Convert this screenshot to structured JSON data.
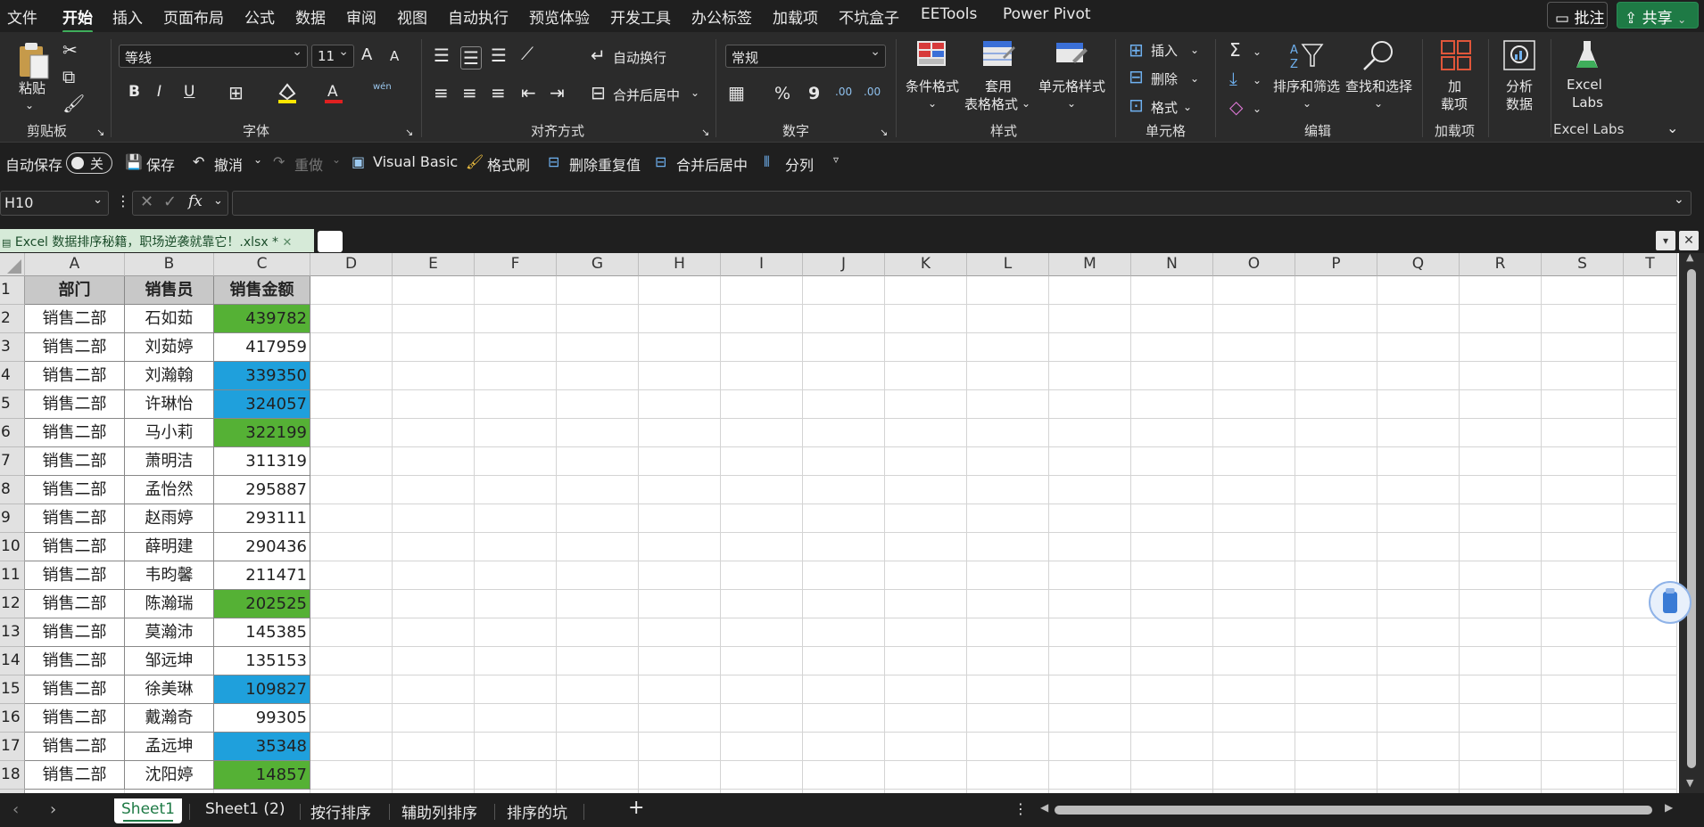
{
  "menubar": {
    "items": [
      "文件",
      "开始",
      "插入",
      "页面布局",
      "公式",
      "数据",
      "审阅",
      "视图",
      "自动执行",
      "预览体验",
      "开发工具",
      "办公标签",
      "加载项",
      "不坑盒子",
      "EETools",
      "Power Pivot"
    ],
    "active": "开始",
    "comments_label": "批注",
    "share_label": "共享"
  },
  "ribbon": {
    "clipboard": {
      "paste": "粘贴",
      "label": "剪贴板"
    },
    "font": {
      "name": "等线",
      "size": "11",
      "bold": "B",
      "italic": "I",
      "underline": "U",
      "label": "字体",
      "grow": "A",
      "shrink": "A",
      "pinyin": "wén"
    },
    "alignment": {
      "wrap": "自动换行",
      "merge": "合并后居中",
      "label": "对齐方式"
    },
    "number": {
      "format": "常规",
      "percent": "%",
      "comma": "9",
      "inc": ".00",
      "dec": ".00",
      "label": "数字"
    },
    "styles": {
      "conditional": "条件格式",
      "table_line1": "套用",
      "table_line2": "表格格式",
      "cell_styles": "单元格样式",
      "label": "样式"
    },
    "cells": {
      "insert": "插入",
      "delete": "删除",
      "format": "格式",
      "label": "单元格"
    },
    "editing": {
      "sort": "排序和筛选",
      "find": "查找和选择",
      "label": "编辑"
    },
    "addins": {
      "line1": "加",
      "line2": "载项",
      "label": "加载项"
    },
    "analyze": {
      "line1": "分析",
      "line2": "数据"
    },
    "labs": {
      "line1": "Excel",
      "line2": "Labs",
      "label": "Excel Labs"
    }
  },
  "qat": {
    "autosave": "自动保存",
    "toggle": "关",
    "save": "保存",
    "undo": "撤消",
    "redo": "重做",
    "vba": "Visual Basic",
    "painter": "格式刷",
    "dedupe": "删除重复值",
    "merge": "合并后居中",
    "split": "分列"
  },
  "formula_bar": {
    "cell_ref": "H10",
    "fx": "fx",
    "value": ""
  },
  "file_tab": {
    "name": "Excel 数据排序秘籍，职场逆袭就靠它！.xlsx *"
  },
  "grid": {
    "columns": [
      "A",
      "B",
      "C",
      "D",
      "E",
      "F",
      "G",
      "H",
      "I",
      "J",
      "K",
      "L",
      "M",
      "N",
      "O",
      "P",
      "Q",
      "R",
      "S",
      "T"
    ],
    "headers": [
      "部门",
      "销售员",
      "销售金额"
    ],
    "rows": [
      {
        "n": "2",
        "dept": "销售二部",
        "name": "石如茹",
        "amount": "439782",
        "fill": "#55b135"
      },
      {
        "n": "3",
        "dept": "销售二部",
        "name": "刘茹婷",
        "amount": "417959",
        "fill": ""
      },
      {
        "n": "4",
        "dept": "销售二部",
        "name": "刘瀚翰",
        "amount": "339350",
        "fill": "#1fa0dc"
      },
      {
        "n": "5",
        "dept": "销售二部",
        "name": "许琳怡",
        "amount": "324057",
        "fill": "#1fa0dc"
      },
      {
        "n": "6",
        "dept": "销售二部",
        "name": "马小莉",
        "amount": "322199",
        "fill": "#55b135"
      },
      {
        "n": "7",
        "dept": "销售二部",
        "name": "萧明洁",
        "amount": "311319",
        "fill": ""
      },
      {
        "n": "8",
        "dept": "销售二部",
        "name": "孟怡然",
        "amount": "295887",
        "fill": ""
      },
      {
        "n": "9",
        "dept": "销售二部",
        "name": "赵雨婷",
        "amount": "293111",
        "fill": ""
      },
      {
        "n": "10",
        "dept": "销售二部",
        "name": "薛明建",
        "amount": "290436",
        "fill": ""
      },
      {
        "n": "11",
        "dept": "销售二部",
        "name": "韦昀馨",
        "amount": "211471",
        "fill": ""
      },
      {
        "n": "12",
        "dept": "销售二部",
        "name": "陈瀚瑞",
        "amount": "202525",
        "fill": "#55b135"
      },
      {
        "n": "13",
        "dept": "销售二部",
        "name": "莫瀚沛",
        "amount": "145385",
        "fill": ""
      },
      {
        "n": "14",
        "dept": "销售二部",
        "name": "邹远坤",
        "amount": "135153",
        "fill": ""
      },
      {
        "n": "15",
        "dept": "销售二部",
        "name": "徐美琳",
        "amount": "109827",
        "fill": "#1fa0dc"
      },
      {
        "n": "16",
        "dept": "销售二部",
        "name": "戴瀚奇",
        "amount": "99305",
        "fill": ""
      },
      {
        "n": "17",
        "dept": "销售二部",
        "name": "孟远坤",
        "amount": "35348",
        "fill": "#1fa0dc"
      },
      {
        "n": "18",
        "dept": "销售二部",
        "name": "沈阳婷",
        "amount": "14857",
        "fill": "#55b135"
      }
    ]
  },
  "sheet_tabs": [
    "Sheet1",
    "Sheet1 (2)",
    "按行排序",
    "辅助列排序",
    "排序的坑"
  ],
  "active_sheet": "Sheet1"
}
